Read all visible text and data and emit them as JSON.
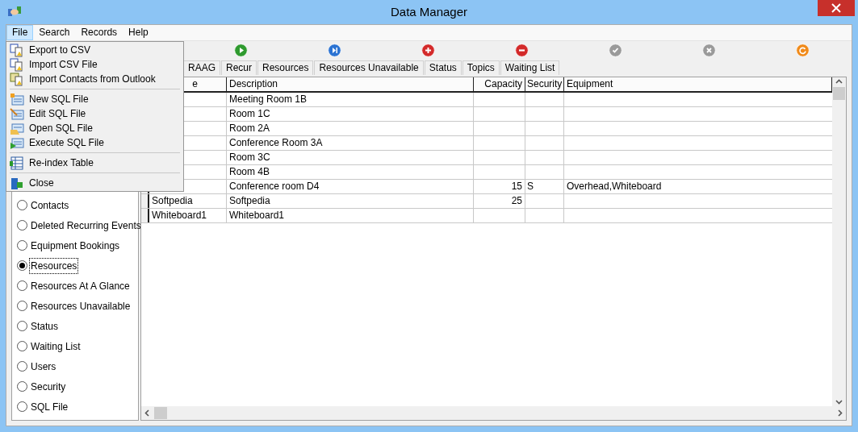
{
  "window": {
    "title": "Data Manager"
  },
  "menu_bar": [
    {
      "label": "File",
      "selected": true
    },
    {
      "label": "Search",
      "selected": false
    },
    {
      "label": "Records",
      "selected": false
    },
    {
      "label": "Help",
      "selected": false
    }
  ],
  "file_menu": [
    {
      "kind": "item",
      "label": "Export to CSV"
    },
    {
      "kind": "item",
      "label": "Import CSV File"
    },
    {
      "kind": "item",
      "label": "Import Contacts from Outlook"
    },
    {
      "kind": "separator"
    },
    {
      "kind": "item",
      "label": "New SQL File"
    },
    {
      "kind": "item",
      "label": "Edit SQL File"
    },
    {
      "kind": "item",
      "label": "Open SQL File"
    },
    {
      "kind": "item",
      "label": "Execute SQL File"
    },
    {
      "kind": "separator"
    },
    {
      "kind": "item",
      "label": "Re-index Table"
    },
    {
      "kind": "separator"
    },
    {
      "kind": "item",
      "label": "Close"
    }
  ],
  "toolbar": [
    {
      "disabled": false
    },
    {
      "disabled": false
    },
    {
      "disabled": false
    },
    {
      "disabled": false
    },
    {
      "disabled": true
    },
    {
      "disabled": true
    },
    {
      "disabled": false
    }
  ],
  "tabs": [
    {
      "label": "RAAG"
    },
    {
      "label": "Recur"
    },
    {
      "label": "Resources"
    },
    {
      "label": "Resources Unavailable"
    },
    {
      "label": "Status"
    },
    {
      "label": "Topics"
    },
    {
      "label": "Waiting List"
    }
  ],
  "sidebar": {
    "options": [
      {
        "label": "Contacts",
        "selected": false
      },
      {
        "label": "Deleted Recurring Events",
        "selected": false
      },
      {
        "label": "Equipment Bookings",
        "selected": false
      },
      {
        "label": "Resources",
        "selected": true
      },
      {
        "label": "Resources At A Glance",
        "selected": false
      },
      {
        "label": "Resources Unavailable",
        "selected": false
      },
      {
        "label": "Status",
        "selected": false
      },
      {
        "label": "Waiting List",
        "selected": false
      },
      {
        "label": "Users",
        "selected": false
      },
      {
        "label": "Security",
        "selected": false
      },
      {
        "label": "SQL File",
        "selected": false
      }
    ]
  },
  "table": {
    "columns": [
      {
        "label": "e"
      },
      {
        "label": "Description"
      },
      {
        "label": "Capacity"
      },
      {
        "label": "Security"
      },
      {
        "label": "Equipment"
      }
    ],
    "rows": [
      {
        "description": "Meeting Room 1B"
      },
      {
        "description": "Room 1C"
      },
      {
        "description": "Room 2A"
      },
      {
        "description": "Conference Room 3A"
      },
      {
        "description": "Room 3C"
      },
      {
        "description": "Room 4B"
      },
      {
        "description": "Conference room D4",
        "capacity": "15",
        "security": "S",
        "equipment": "Overhead,Whiteboard"
      },
      {
        "name": "Softpedia",
        "description": "Softpedia",
        "capacity": "25"
      },
      {
        "name": "Whiteboard1",
        "description": "Whiteboard1"
      }
    ]
  }
}
